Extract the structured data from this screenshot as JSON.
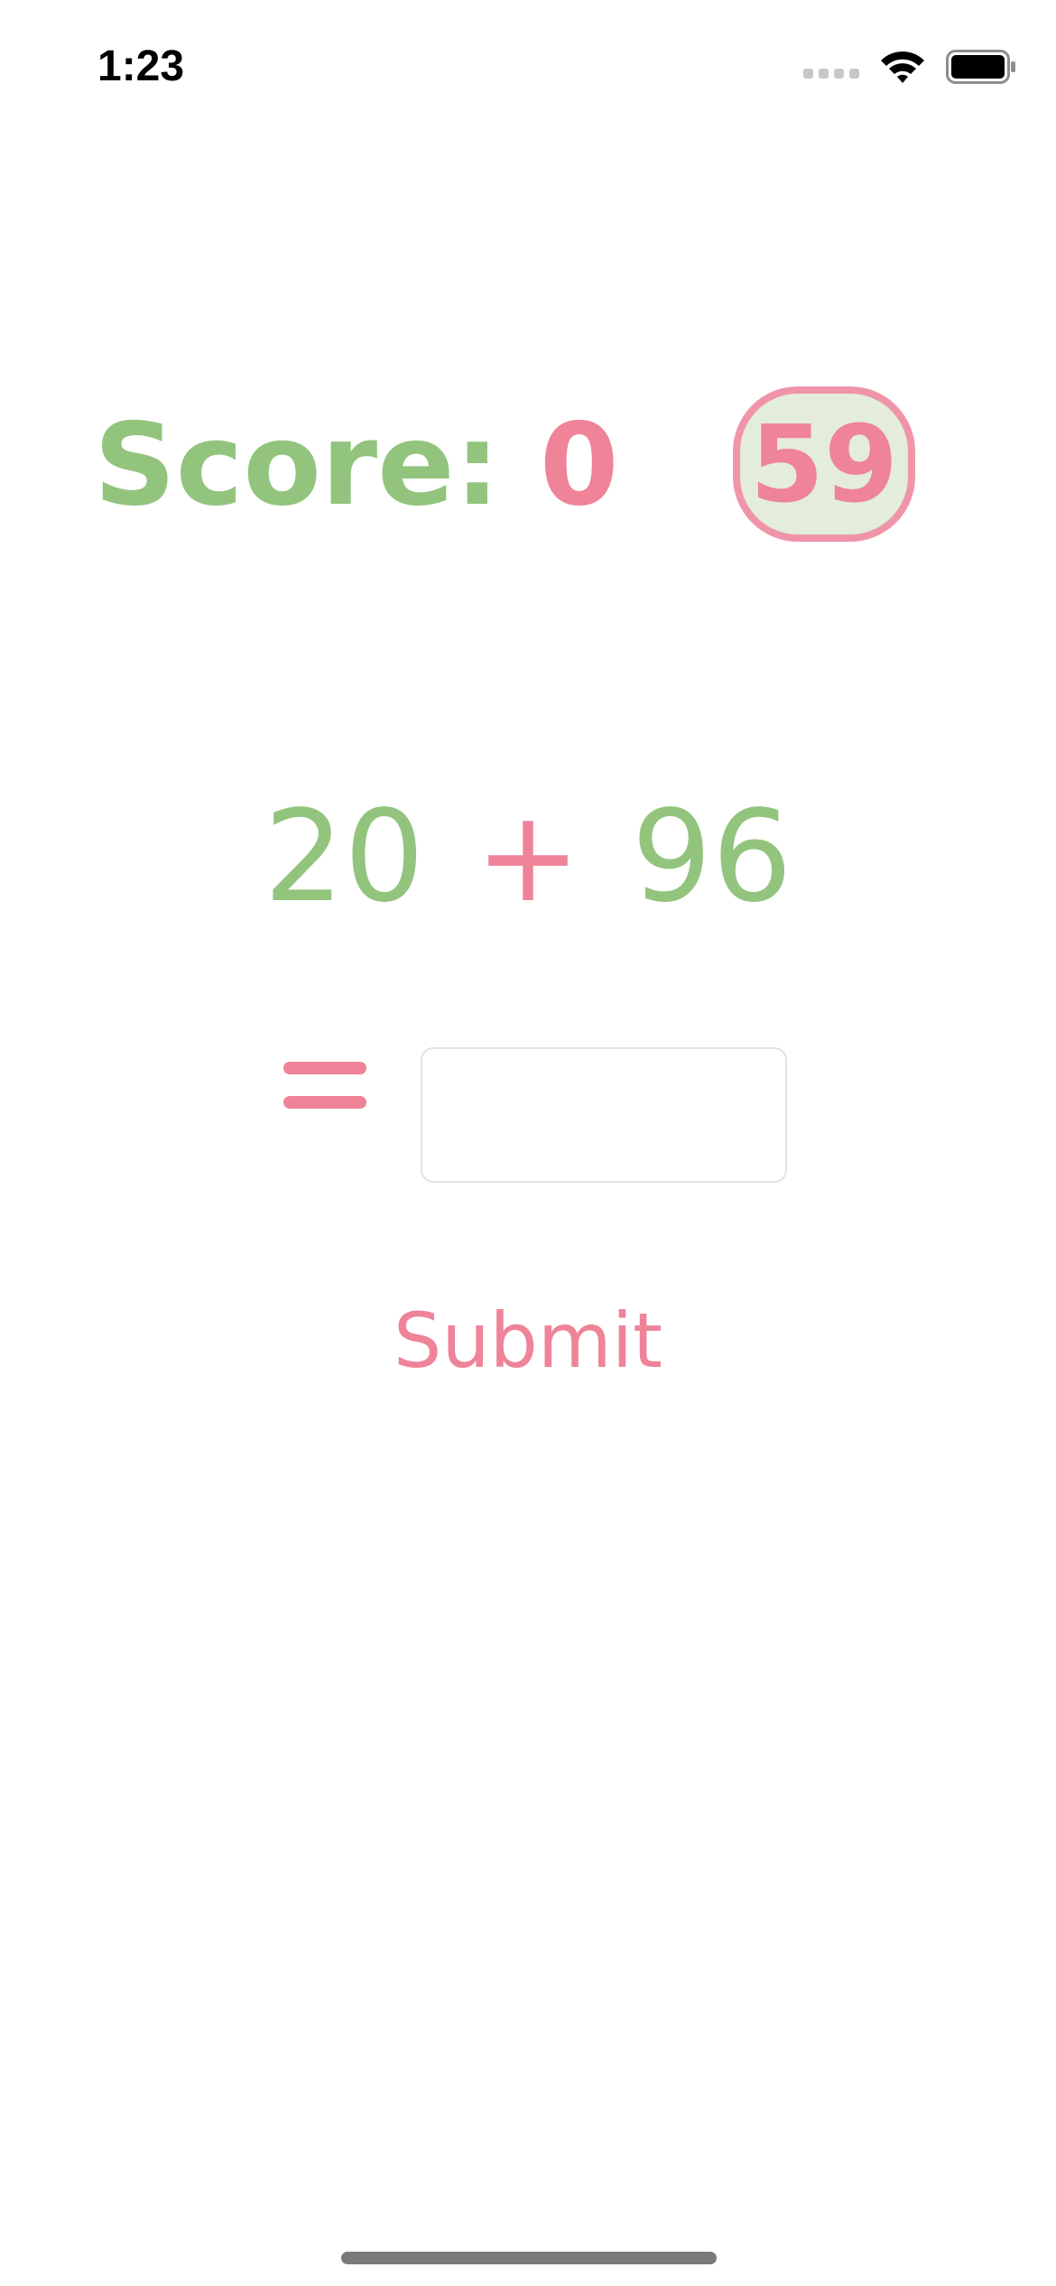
{
  "status_bar": {
    "time": "1:23",
    "signal_icon": "signal-dots-icon",
    "wifi_icon": "wifi-icon",
    "battery_icon": "battery-icon"
  },
  "game": {
    "score_label": "Score:",
    "score_value": "0",
    "timer_value": "59",
    "operand_a": "20",
    "operator": "+",
    "operand_b": "96",
    "equals_icon": "equals-icon",
    "answer_value": "",
    "answer_placeholder": "",
    "submit_label": "Submit"
  },
  "colors": {
    "green": "#92c47d",
    "pink": "#ef8398",
    "timer_border": "#f095a9",
    "timer_background": "#e3edda"
  }
}
